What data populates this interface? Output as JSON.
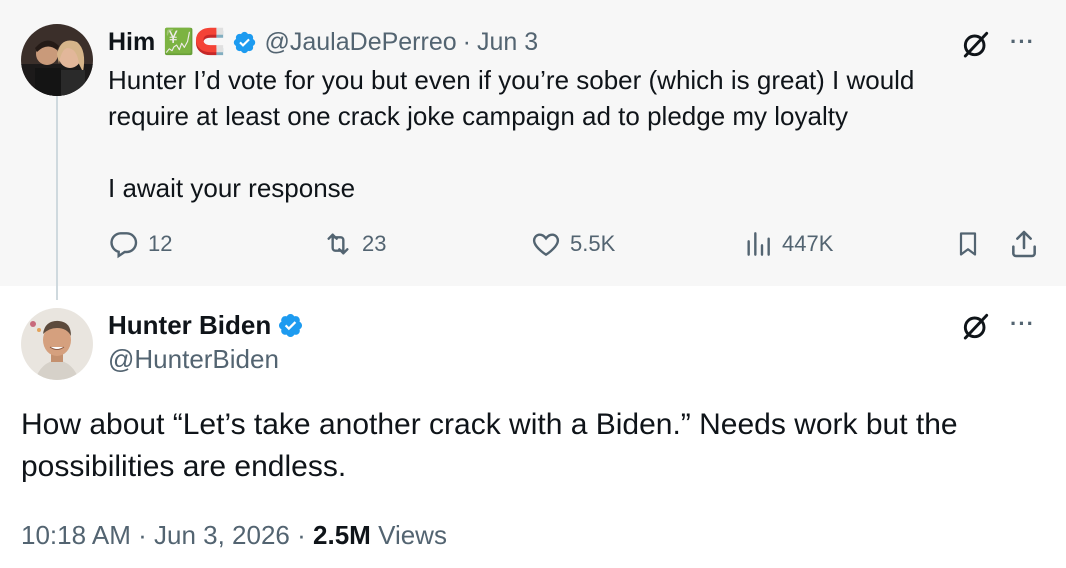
{
  "parent_tweet": {
    "name": "Him",
    "emojis": "💹🧲",
    "handle": "@JaulaDePerreo",
    "separator": "·",
    "date": "Jun 3",
    "text_line1": "Hunter I’d vote for you but even if you’re sober (which is great) I would require at least one crack joke campaign ad to pledge my loyalty",
    "text_line2": "I await your response",
    "replies": "12",
    "reposts": "23",
    "likes": "5.5K",
    "views": "447K",
    "more_label": "···"
  },
  "main_tweet": {
    "name": "Hunter Biden",
    "handle": "@HunterBiden",
    "text": "How about “Let’s take another crack with a Biden.” Needs work but the possibilities are endless.",
    "time": "10:18 AM",
    "sep1": "·",
    "date": "Jun 3, 2026",
    "sep2": "·",
    "views_count": "2.5M",
    "views_label": "Views",
    "more_label": "···"
  },
  "colors": {
    "verified": "#1d9bf0",
    "secondary_text": "#536471",
    "parent_bg": "#f7f7f7",
    "thread_line": "#cfd9de"
  },
  "icons": [
    "grok-icon",
    "more-icon",
    "reply-icon",
    "repost-icon",
    "like-icon",
    "views-icon",
    "bookmark-icon",
    "share-icon",
    "verified-badge-icon"
  ]
}
